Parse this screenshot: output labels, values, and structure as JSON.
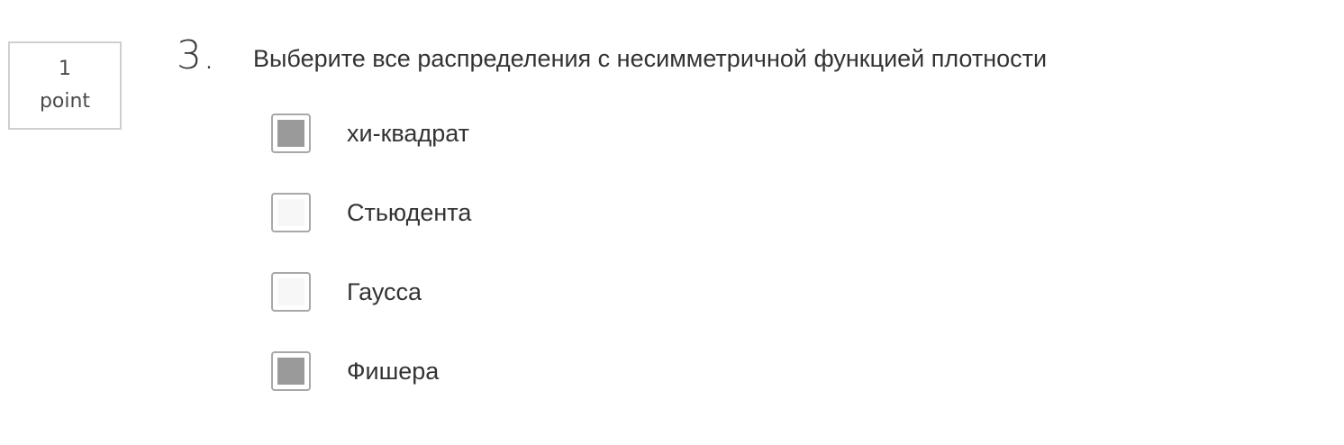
{
  "points": {
    "value": "1",
    "unit": "point"
  },
  "question": {
    "number": "3.",
    "text": "Выберите все распределения с несимметричной функцией плотности"
  },
  "options": [
    {
      "label": "хи-квадрат",
      "checked": true
    },
    {
      "label": "Стьюдента",
      "checked": false
    },
    {
      "label": "Гаусса",
      "checked": false
    },
    {
      "label": "Фишера",
      "checked": true
    }
  ],
  "colors": {
    "checkbox_border": "#a8a8a8",
    "checkbox_fill": "#9a9a9a",
    "text": "#333333"
  }
}
